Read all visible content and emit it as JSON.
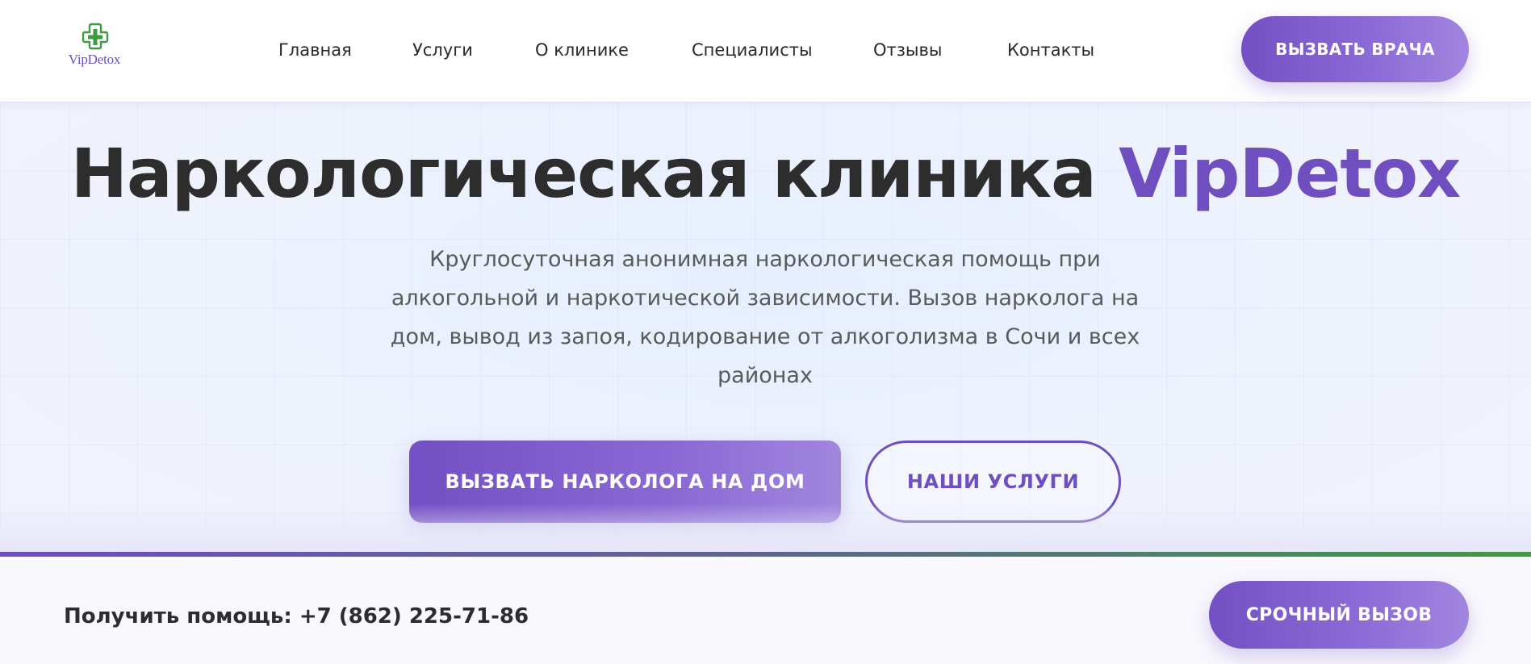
{
  "header": {
    "logo_text": "VipDetox",
    "nav": [
      {
        "label": "Главная"
      },
      {
        "label": "Услуги"
      },
      {
        "label": "О клинике"
      },
      {
        "label": "Специалисты"
      },
      {
        "label": "Отзывы"
      },
      {
        "label": "Контакты"
      }
    ],
    "cta_label": "ВЫЗВАТЬ ВРАЧА"
  },
  "hero": {
    "title_main": "Наркологическая клиника ",
    "title_brand": "VipDetox",
    "subtitle": "Круглосуточная анонимная наркологическая помощь при алкогольной и наркотической зависимости. Вызов нарколога на дом, вывод из запоя, кодирование от алкоголизма в Сочи и всех районах",
    "primary_button": "ВЫЗВАТЬ НАРКОЛОГА НА ДОМ",
    "secondary_button": "НАШИ УСЛУГИ"
  },
  "bottom_bar": {
    "help_text": "Получить помощь: +7 (862) 225-71-86",
    "urgent_button": "СРОЧНЫЙ ВЫЗОВ"
  },
  "colors": {
    "accent": "#6f4ec0",
    "logo_cross": "#3e9a43",
    "divider_start": "#6f4ec0",
    "divider_end": "#3e9a43"
  },
  "icons": {
    "logo": "medical-cross-icon"
  }
}
